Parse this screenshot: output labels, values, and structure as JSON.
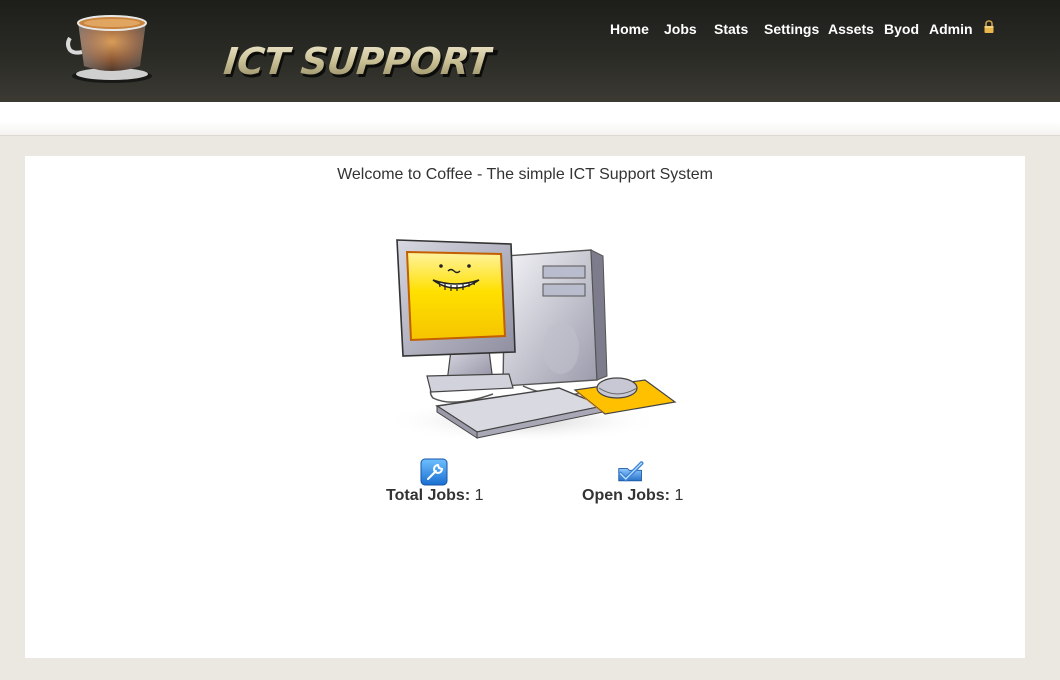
{
  "header": {
    "logo_text": "ICT SUPPORT",
    "nav": [
      {
        "label": "Home"
      },
      {
        "label": "Jobs"
      },
      {
        "label": "Stats"
      },
      {
        "label": "Settings"
      },
      {
        "label": "Assets"
      },
      {
        "label": "Byod"
      },
      {
        "label": "Admin"
      }
    ],
    "lock_icon": "lock-icon"
  },
  "main": {
    "welcome": "Welcome to Coffee - The simple ICT Support System",
    "stats": {
      "total_label": "Total Jobs:",
      "total_value": "1",
      "open_label": "Open Jobs:",
      "open_value": "1"
    },
    "icons": {
      "total": "wrench-icon",
      "open": "folder-check-icon"
    }
  },
  "colors": {
    "header_bg": "#2b2b26",
    "page_bg": "#ebe8e1",
    "panel_bg": "#ffffff",
    "screen_yellow": "#ffd700",
    "accent_blue": "#2a8fe3"
  }
}
